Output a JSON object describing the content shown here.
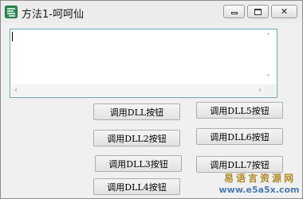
{
  "window": {
    "title": "方法1-呵呵仙",
    "icon": "app-icon"
  },
  "titlebar": {
    "minimize_icon": "minimize-icon",
    "maximize_icon": "maximize-icon",
    "close_glyph": "✕"
  },
  "textbox": {
    "value": "",
    "scroll_left_glyph": "‹",
    "scroll_right_glyph": "›",
    "scroll_up_glyph": "˄",
    "scroll_down_glyph": "˅"
  },
  "buttons": [
    {
      "label": "调用DLL按钮"
    },
    {
      "label": "调用DLL2按钮"
    },
    {
      "label": "调用DLL3按钮"
    },
    {
      "label": "调用DLL4按钮"
    },
    {
      "label": "调用DLL5按钮"
    },
    {
      "label": "调用DLL6按钮"
    },
    {
      "label": "调用DLL7按钮"
    }
  ],
  "watermark": {
    "line1": "易语言资源网",
    "line2": "www.e5a5x.com"
  },
  "colors": {
    "titlebar_bg": "#ececec",
    "client_bg": "#f0f0f0",
    "textbox_border": "#6aa6b3",
    "watermark_cn": "#b08a2a",
    "watermark_url": "#4a7bb0"
  }
}
